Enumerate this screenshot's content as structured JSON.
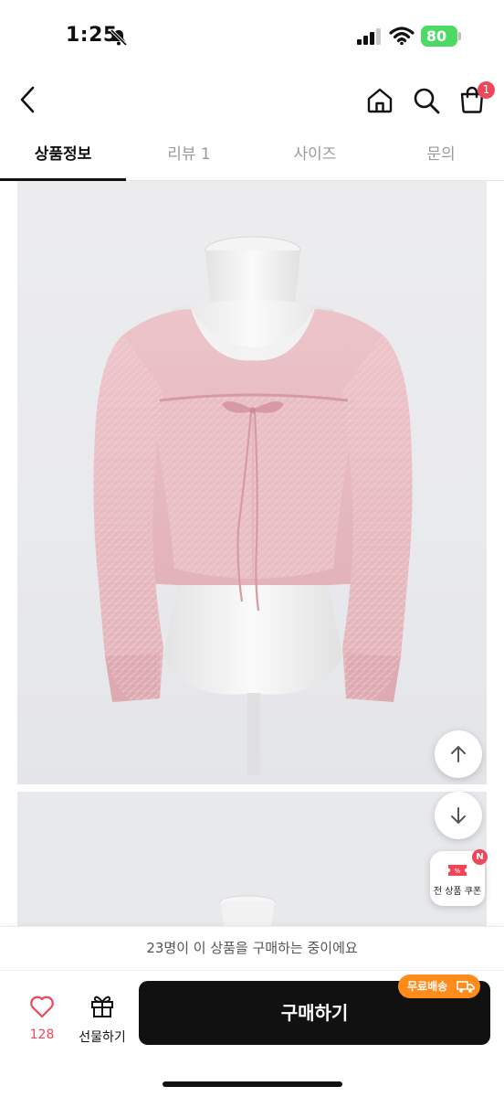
{
  "status_bar": {
    "time": "1:25",
    "battery": "80"
  },
  "header": {
    "cart_count": "1",
    "icons": [
      "back-icon",
      "home-icon",
      "search-icon",
      "cart-icon"
    ]
  },
  "tabs": [
    {
      "label": "상품정보",
      "active": true
    },
    {
      "label": "리뷰 1",
      "active": false
    },
    {
      "label": "사이즈",
      "active": false
    },
    {
      "label": "문의",
      "active": false
    }
  ],
  "floating": {
    "coupon_label": "전 상품 쿠폰",
    "coupon_badge": "N"
  },
  "bottom": {
    "purchase_notice": "23명이 이 상품을 구매하는 중이에요",
    "like_count": "128",
    "gift_label": "선물하기",
    "buy_label": "구매하기",
    "free_shipping": "무료배송"
  },
  "colors": {
    "accent": "#f0465a",
    "buy_button": "#111111",
    "free_shipping_badge": "#ff8c1a",
    "battery": "#4cd964",
    "sweater": "#e7bcc2",
    "ribbon": "#d89aa2"
  }
}
